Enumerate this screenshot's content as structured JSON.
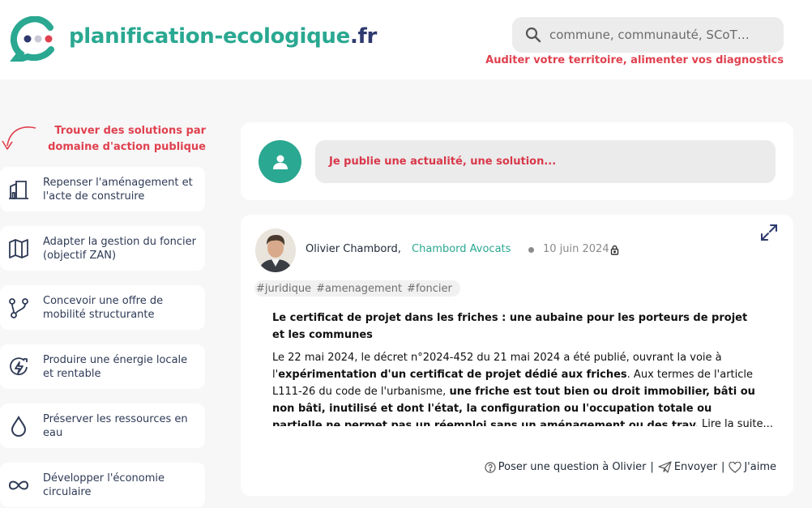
{
  "header": {
    "brand_main": "planification-ecologique",
    "brand_tld": ".fr",
    "search_placeholder": "commune, communauté, SCoT…",
    "tagline": "Auditer votre territoire, alimenter vos diagnostics",
    "colors": {
      "brand": "#2aa891",
      "tld": "#2e3a6e",
      "accent": "#e0414f"
    }
  },
  "sidebar": {
    "prompt": "Trouver des solutions par domaine d'action publique",
    "items": [
      {
        "label": "Repenser l'aménagement et l'acte de construire",
        "icon": "building-icon"
      },
      {
        "label": "Adapter la gestion du foncier (objectif ZAN)",
        "icon": "map-icon"
      },
      {
        "label": "Concevoir une offre de mobilité structurante",
        "icon": "route-icon"
      },
      {
        "label": "Produire une énergie locale et rentable",
        "icon": "energy-icon"
      },
      {
        "label": "Préserver les ressources en eau",
        "icon": "water-drop-icon"
      },
      {
        "label": "Développer l'économie circulaire",
        "icon": "infinity-icon"
      }
    ]
  },
  "composer": {
    "button": "Je publie une actualité, une solution..."
  },
  "post": {
    "author": "Olivier Chambord,",
    "organization": "Chambord Avocats",
    "date": "10 juin 2024",
    "tags": [
      "#juridique",
      "#amenagement",
      "#foncier"
    ],
    "title": "Le certificat de projet dans les friches : une aubaine pour les porteurs de projet et les communes",
    "p1": "Le 22 mai 2024, le décret n°2024-452 du 21 mai 2024 a été publié, ouvrant la voie à l'",
    "p1_bold": "expérimentation d'un certificat de projet dédié aux friches",
    "p2": ". Aux termes de l'article L111-26 du code de l'urbanisme, ",
    "p2_bold": "une friche est tout bien ou droit immobilier, bâti ou non bâti, inutilisé et dont l'état, la configuration ou l'occupation totale ou partielle ne permet pas un réemploi sans un aménagement ou des travaux préalables",
    "p2_end": ".",
    "read_more": "Lire la suite...",
    "actions": {
      "ask": "Poser une question à Olivier",
      "send": "Envoyer",
      "like": "J'aime",
      "sep": "|"
    }
  }
}
